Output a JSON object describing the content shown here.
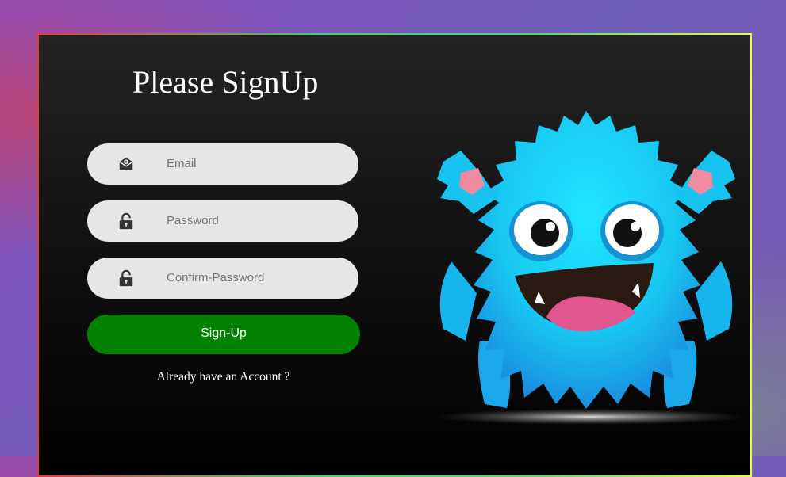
{
  "page": {
    "title": "Please SignUp"
  },
  "form": {
    "email_placeholder": "Email",
    "password_placeholder": "Password",
    "confirm_placeholder": "Confirm-Password",
    "submit_label": "Sign-Up",
    "login_link": "Already have an Account ?"
  },
  "icons": {
    "email": "email-envelope-icon",
    "password": "lock-icon",
    "confirm": "lock-icon"
  },
  "colors": {
    "button": "#028102",
    "input_bg": "#e6e6e6",
    "monster": "#1ec7f0"
  }
}
